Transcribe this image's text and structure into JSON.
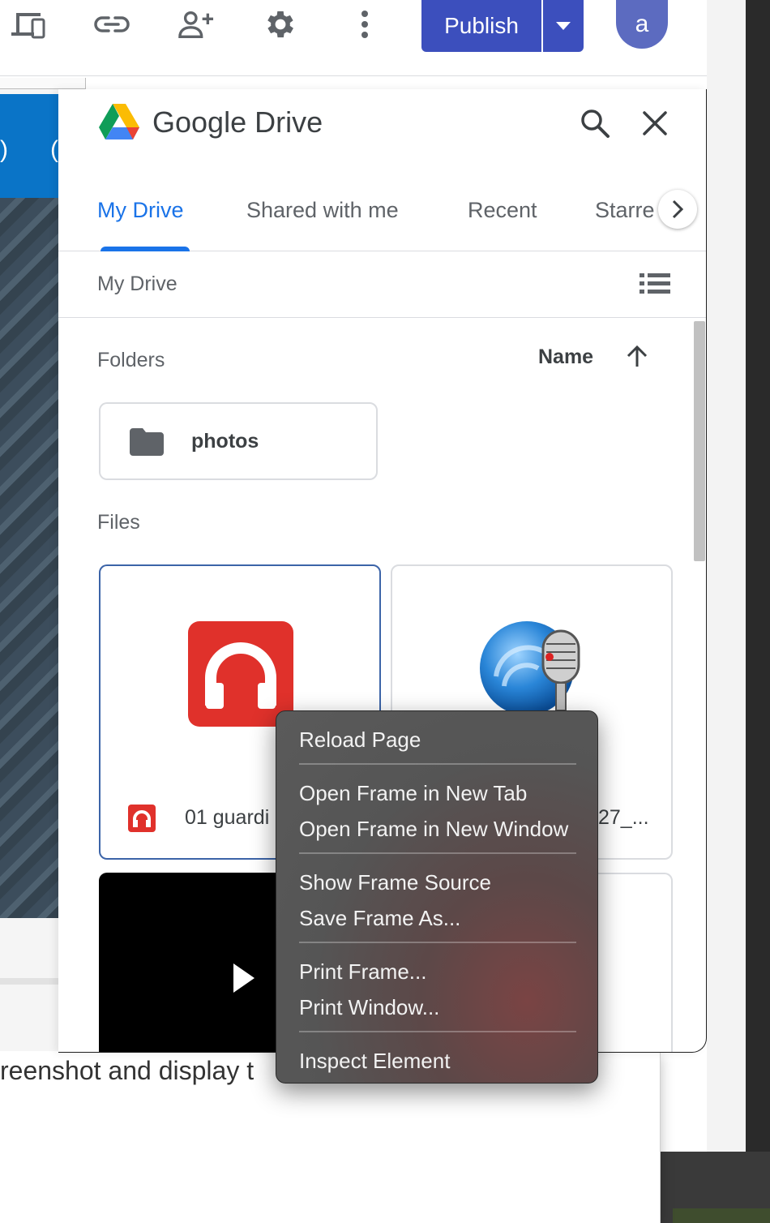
{
  "toolbar": {
    "publish_label": "Publish",
    "avatar_initial": "a"
  },
  "background": {
    "left_blue_text": ")",
    "left_blue_text2": "(",
    "lower_text": "reenshot and display t"
  },
  "drive": {
    "title": "Google Drive",
    "tabs": [
      {
        "label": "My Drive"
      },
      {
        "label": "Shared with me"
      },
      {
        "label": "Recent"
      },
      {
        "label": "Starre"
      }
    ],
    "breadcrumb": "My Drive",
    "folders_label": "Folders",
    "sort_label": "Name",
    "folders": [
      {
        "name": "photos"
      }
    ],
    "files_label": "Files",
    "files": [
      {
        "name": "01 guardi"
      },
      {
        "name": "27_..."
      }
    ]
  },
  "context_menu": {
    "items": [
      "Reload Page",
      "Open Frame in New Tab",
      "Open Frame in New Window",
      "Show Frame Source",
      "Save Frame As...",
      "Print Frame...",
      "Print Window...",
      "Inspect Element"
    ]
  },
  "colors": {
    "accent": "#1a73e8",
    "publish": "#3c4fbd",
    "avatar": "#5c6bc0",
    "audio_red": "#e0312b"
  },
  "icons": [
    "devices-icon",
    "link-icon",
    "add-person-icon",
    "gear-icon",
    "more-vert-icon",
    "caret-down-icon",
    "drive-logo-icon",
    "search-icon",
    "close-icon",
    "chevron-right-icon",
    "list-view-icon",
    "arrow-up-icon",
    "folder-icon",
    "headphones-icon",
    "microphone-icon",
    "play-icon"
  ]
}
